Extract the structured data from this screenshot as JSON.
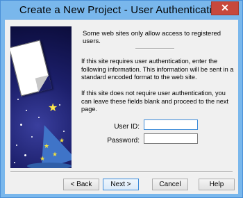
{
  "window": {
    "title": "Create a New Project - User Authentication",
    "close_glyph": "✕"
  },
  "banner": {
    "icons": [
      "page-icon",
      "wizard-hat-icon",
      "star-icon"
    ]
  },
  "content": {
    "intro": "Some web sites only allow access to registered users.",
    "paragraph1": "If this site requires user authentication, enter the following information. This information will be sent in a standard encoded format to the web site.",
    "paragraph2": "If this site does not require user authentication, you can leave these fields blank and proceed to the next page.",
    "user_id_label": "User ID:",
    "user_id_value": "",
    "password_label": "Password:",
    "password_value": ""
  },
  "buttons": {
    "back": "< Back",
    "next": "Next >",
    "cancel": "Cancel",
    "help": "Help"
  },
  "colors": {
    "frame": "#79b7ec",
    "dialog_bg": "#f0f0f0",
    "close_button": "#c7483c",
    "focus_border": "#3b8ad8"
  }
}
